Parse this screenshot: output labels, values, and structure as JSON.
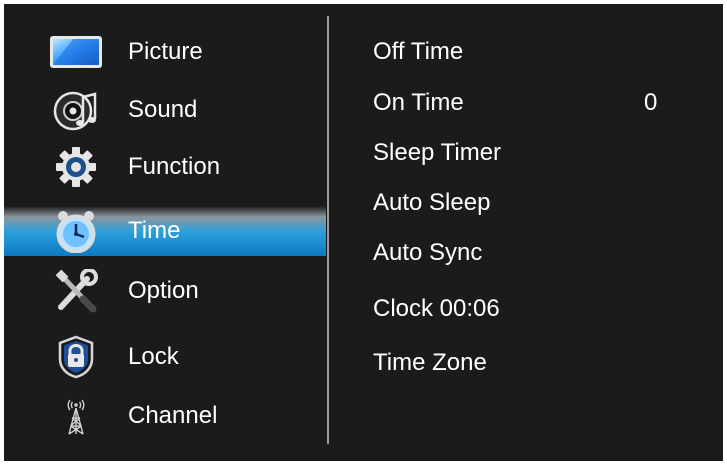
{
  "menu": {
    "items": [
      {
        "label": "Picture",
        "icon": "picture-icon"
      },
      {
        "label": "Sound",
        "icon": "sound-icon"
      },
      {
        "label": "Function",
        "icon": "gear-icon"
      },
      {
        "label": "Time",
        "icon": "clock-icon",
        "selected": true
      },
      {
        "label": "Option",
        "icon": "tools-icon"
      },
      {
        "label": "Lock",
        "icon": "lock-icon"
      },
      {
        "label": "Channel",
        "icon": "antenna-icon"
      }
    ]
  },
  "time_settings": {
    "items": [
      {
        "label": "Off Time",
        "value": ""
      },
      {
        "label": "On Time",
        "value": "0"
      },
      {
        "label": "Sleep Timer",
        "value": ""
      },
      {
        "label": "Auto Sleep",
        "value": ""
      },
      {
        "label": "Auto Sync",
        "value": ""
      },
      {
        "label": "Clock 00:06",
        "value": ""
      },
      {
        "label": "Time Zone",
        "value": ""
      }
    ]
  },
  "colors": {
    "background": "#1b1b1b",
    "highlight": "#1e8fd0",
    "text": "#ffffff"
  }
}
